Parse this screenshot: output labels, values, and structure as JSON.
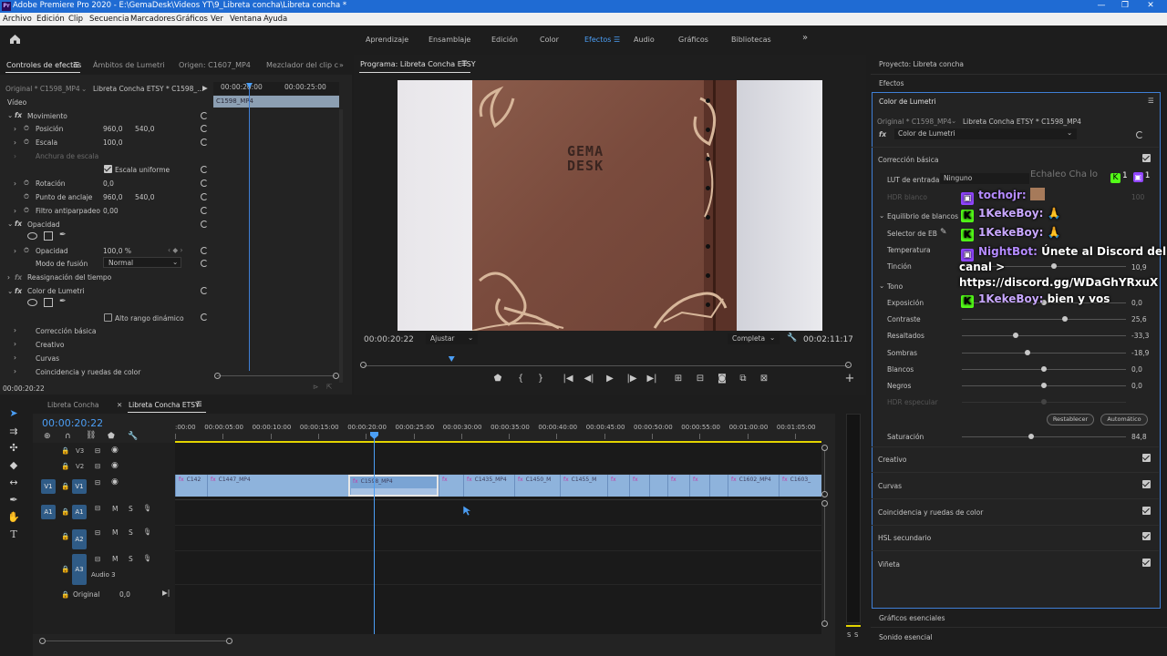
{
  "title_bar": {
    "icon": "Pr",
    "title": "Adobe Premiere Pro 2020 - E:\\GemaDesk\\Videos YT\\9_Libreta concha\\Libreta concha *",
    "minimize": "—",
    "maximize": "❐",
    "close": "✕"
  },
  "menu": [
    "Archivo",
    "Edición",
    "Clip",
    "Secuencia",
    "Marcadores",
    "Gráficos",
    "Ver",
    "Ventana",
    "Ayuda"
  ],
  "workspaces": {
    "items": [
      "Aprendizaje",
      "Ensamblaje",
      "Edición",
      "Color",
      "Efectos",
      "Audio",
      "Gráficos",
      "Bibliotecas"
    ],
    "active": "Efectos",
    "more": "»"
  },
  "effect_controls": {
    "tabs": [
      "Controles de efectos",
      "Ámbitos de Lumetri",
      "Origen: C1607_MP4",
      "Mezclador del clip c"
    ],
    "source_label": "Original * C1598_MP4",
    "sequence_label": "Libreta Concha ETSY * C1598_...",
    "mini_time_1": "00:00:20:00",
    "mini_time_2": "00:00:25:00",
    "mini_clip": "C1598_MP4",
    "video_label": "Vídeo",
    "motion_label": "Movimiento",
    "position_label": "Posición",
    "position_x": "960,0",
    "position_y": "540,0",
    "scale_label": "Escala",
    "scale_value": "100,0",
    "scale_width_label": "Anchura de escala",
    "uniform_scale_label": "Escala uniforme",
    "rotation_label": "Rotación",
    "rotation_value": "0,0",
    "anchor_label": "Punto de anclaje",
    "anchor_x": "960,0",
    "anchor_y": "540,0",
    "antiflicker_label": "Filtro antiparpadeo",
    "antiflicker_value": "0,00",
    "opacity_section": "Opacidad",
    "opacity_label": "Opacidad",
    "opacity_value": "100,0 %",
    "blend_label": "Modo de fusión",
    "blend_value": "Normal",
    "time_remap_label": "Reasignación del tiempo",
    "lumetri_label": "Color de Lumetri",
    "hdr_label": "Alto rango dinámico",
    "sub_items": [
      "Corrección básica",
      "Creativo",
      "Curvas",
      "Coincidencia y ruedas de color"
    ],
    "timecode": "00:00:20:22"
  },
  "program": {
    "title": "Programa: Libreta Concha ETSY",
    "timecode": "00:00:20:22",
    "fit": "Ajustar",
    "quality": "Completa",
    "duration": "00:02:11:17",
    "brand_line1": "GEMA",
    "brand_line2": "DESK",
    "playhead_progress": 0.18
  },
  "timeline": {
    "tabs": [
      "Libreta Concha",
      "Libreta Concha ETSY"
    ],
    "timecode": "00:00:20:22",
    "ruler": [
      ":00:00",
      "00:00:05:00",
      "00:00:10:00",
      "00:00:15:00",
      "00:00:20:00",
      "00:00:25:00",
      "00:00:30:00",
      "00:00:35:00",
      "00:00:40:00",
      "00:00:45:00",
      "00:00:50:00",
      "00:00:55:00",
      "00:01:00:00",
      "00:01:05:00"
    ],
    "tracks_video": [
      "V3",
      "V2",
      "V1"
    ],
    "tracks_audio": [
      "A1",
      "A2",
      "A3"
    ],
    "src_v1": "V1",
    "src_a1": "A1",
    "audio3_name": "Audio 3",
    "mute_label": "M",
    "solo_label": "S",
    "master_label": "Original",
    "master_value": "0,0",
    "clips": [
      "C142",
      "C1447_MP4",
      "C1598_MP4",
      "C1435_MP4",
      "C1450_M",
      "C1455_M",
      "C1602_MP4",
      "C1603_"
    ]
  },
  "audio_meter": {
    "labels": [
      "S",
      "S"
    ]
  },
  "right_panel": {
    "project": "Proyecto: Libreta concha",
    "effects": "Efectos",
    "lumetri_title": "Color de Lumetri",
    "source_label": "Original * C1598_MP4",
    "sequence_label": "Libreta Concha ETSY * C1598_MP4",
    "effect_select": "Color de Lumetri",
    "basic_correction": "Corrección básica",
    "lut_label": "LUT de entrada",
    "lut_value": "Ninguno",
    "hdr_white": "HDR blanco",
    "hdr_white_value": "100",
    "wb_section": "Equilibrio de blancos",
    "wb_selector": "Selector de EB",
    "temperature": "Temperatura",
    "tint": "Tinción",
    "tint_value": "10,9",
    "tone": "Tono",
    "sliders": [
      {
        "label": "Exposición",
        "value": "0,0",
        "pos": 0.5
      },
      {
        "label": "Contraste",
        "value": "25,6",
        "pos": 0.63
      },
      {
        "label": "Resaltados",
        "value": "-33,3",
        "pos": 0.33
      },
      {
        "label": "Sombras",
        "value": "-18,9",
        "pos": 0.4
      },
      {
        "label": "Blancos",
        "value": "0,0",
        "pos": 0.5
      },
      {
        "label": "Negros",
        "value": "0,0",
        "pos": 0.5
      },
      {
        "label": "HDR especular",
        "value": "",
        "pos": 0.5
      }
    ],
    "reset_btn": "Restablecer",
    "auto_btn": "Automático",
    "saturation": "Saturación",
    "saturation_value": "84,8",
    "saturation_pos": 0.42,
    "sections": [
      "Creativo",
      "Curvas",
      "Coincidencia y ruedas de color",
      "HSL secundario",
      "Viñeta"
    ],
    "essential_graphics": "Gráficos esenciales",
    "essential_sound": "Sonido esencial"
  },
  "chat_overlay": {
    "faded_header": "Echaleo Cha lo",
    "kick_count": "1",
    "twitch_count": "1",
    "messages": [
      {
        "platform": "twitch",
        "user": "tochojr:",
        "text": ""
      },
      {
        "platform": "kick",
        "user": "1KekeBoy:",
        "text": ""
      },
      {
        "platform": "kick",
        "user": "1KekeBoy:",
        "text": ""
      },
      {
        "platform": "twitch",
        "user": "NightBot:",
        "text": "Únete al Discord del"
      },
      {
        "platform": "",
        "user": "",
        "text": "canal >"
      },
      {
        "platform": "",
        "user": "",
        "text": "https://discord.gg/WDaGhYRxuX"
      },
      {
        "platform": "kick",
        "user": "1KekeBoy:",
        "text": "bien y vos"
      }
    ]
  }
}
